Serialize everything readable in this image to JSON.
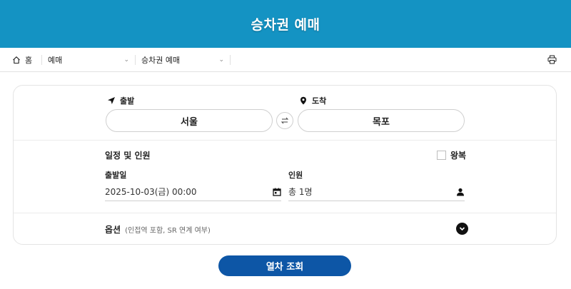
{
  "header": {
    "title": "승차권 예매"
  },
  "breadcrumb": {
    "home_label": "홈",
    "home_icon": "home-icon",
    "menu1": "예매",
    "menu2": "승차권 예매",
    "print_icon": "printer-icon"
  },
  "route": {
    "departure_label": "출발",
    "departure_icon": "location-arrow-icon",
    "departure_value": "서울",
    "arrival_label": "도착",
    "arrival_icon": "map-pin-icon",
    "arrival_value": "목포",
    "swap_icon": "swap-icon"
  },
  "schedule": {
    "section_title": "일정 및 인원",
    "roundtrip_label": "왕복",
    "roundtrip_checked": false,
    "date_label": "출발일",
    "date_value": "2025-10-03(금) 00:00",
    "date_icon": "calendar-icon",
    "passengers_label": "인원",
    "passengers_value": "총 1명",
    "passengers_icon": "person-icon"
  },
  "options": {
    "title": "옵션",
    "subtitle": "(인접역 포함, SR 연계 여부)",
    "toggle_icon": "chevron-down-circle-icon"
  },
  "search_button": {
    "label": "열차 조회"
  },
  "colors": {
    "header_bg": "#1493c3",
    "button_bg": "#0d56a6"
  }
}
